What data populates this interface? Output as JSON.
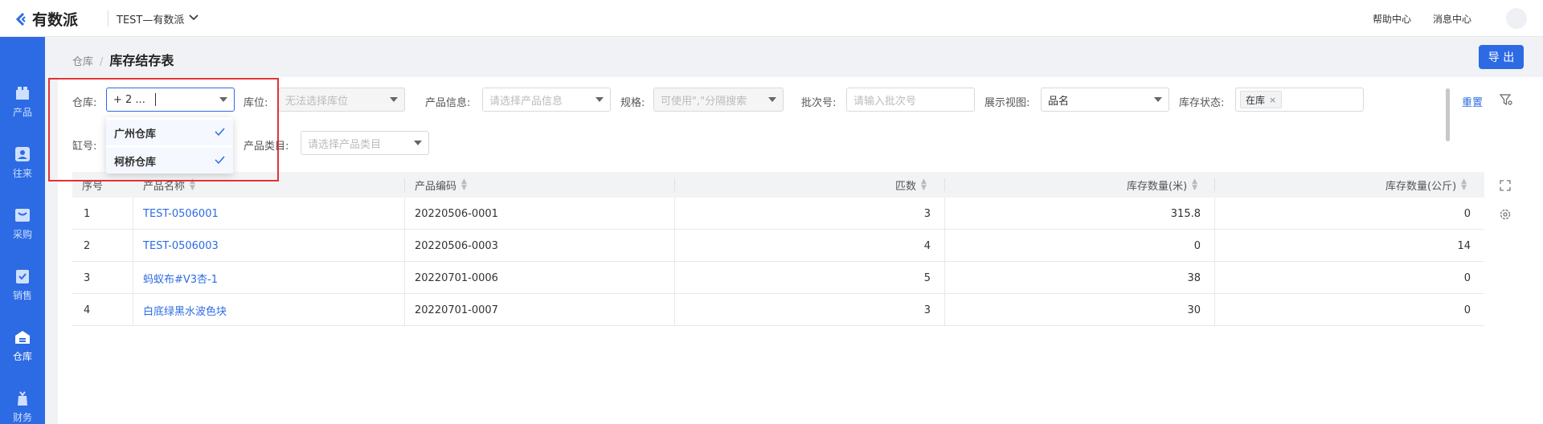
{
  "topbar": {
    "logo_text": "有数派",
    "tenant": "TEST—有数派",
    "help": "帮助中心",
    "messages": "消息中心"
  },
  "sidebar": {
    "items": [
      {
        "label": "产品",
        "icon": "product-icon"
      },
      {
        "label": "往来",
        "icon": "contacts-icon"
      },
      {
        "label": "采购",
        "icon": "purchase-icon"
      },
      {
        "label": "销售",
        "icon": "sales-icon"
      },
      {
        "label": "仓库",
        "icon": "warehouse-icon",
        "active": true
      },
      {
        "label": "财务",
        "icon": "finance-icon"
      }
    ]
  },
  "breadcrumb": {
    "parent": "仓库",
    "separator": "/",
    "current": "库存结存表"
  },
  "export_label": "导 出",
  "filters": {
    "warehouse": {
      "label": "仓库:",
      "value": "+ 2 ..."
    },
    "location": {
      "label": "库位:",
      "placeholder": "无法选择库位"
    },
    "product_info": {
      "label": "产品信息:",
      "placeholder": "请选择产品信息"
    },
    "spec": {
      "label": "规格:",
      "placeholder": "可使用\",\"分隔搜索"
    },
    "batch": {
      "label": "批次号:",
      "placeholder": "请输入批次号"
    },
    "view": {
      "label": "展示视图:",
      "value": "品名"
    },
    "stock_status": {
      "label": "库存状态:",
      "tag": "在库"
    },
    "vat": {
      "label": "缸号:"
    },
    "category": {
      "label": "产品类目:",
      "placeholder": "请选择产品类目"
    },
    "reset": "重置"
  },
  "warehouse_dropdown": {
    "options": [
      {
        "label": "广州仓库",
        "checked": true
      },
      {
        "label": "柯桥仓库",
        "checked": true
      }
    ]
  },
  "table": {
    "headers": [
      "序号",
      "产品名称",
      "产品编码",
      "匹数",
      "库存数量(米)",
      "库存数量(公斤)"
    ],
    "rows": [
      {
        "no": "1",
        "name": "TEST-0506001",
        "code": "20220506-0001",
        "pieces": "3",
        "meters": "315.8",
        "kg": "0"
      },
      {
        "no": "2",
        "name": "TEST-0506003",
        "code": "20220506-0003",
        "pieces": "4",
        "meters": "0",
        "kg": "14"
      },
      {
        "no": "3",
        "name": "蚂蚁布#V3杏-1",
        "code": "20220701-0006",
        "pieces": "5",
        "meters": "38",
        "kg": "0"
      },
      {
        "no": "4",
        "name": "白底绿黑水波色块",
        "code": "20220701-0007",
        "pieces": "3",
        "meters": "30",
        "kg": "0"
      }
    ]
  },
  "colors": {
    "primary": "#2d6be4",
    "highlight": "#e23232"
  }
}
